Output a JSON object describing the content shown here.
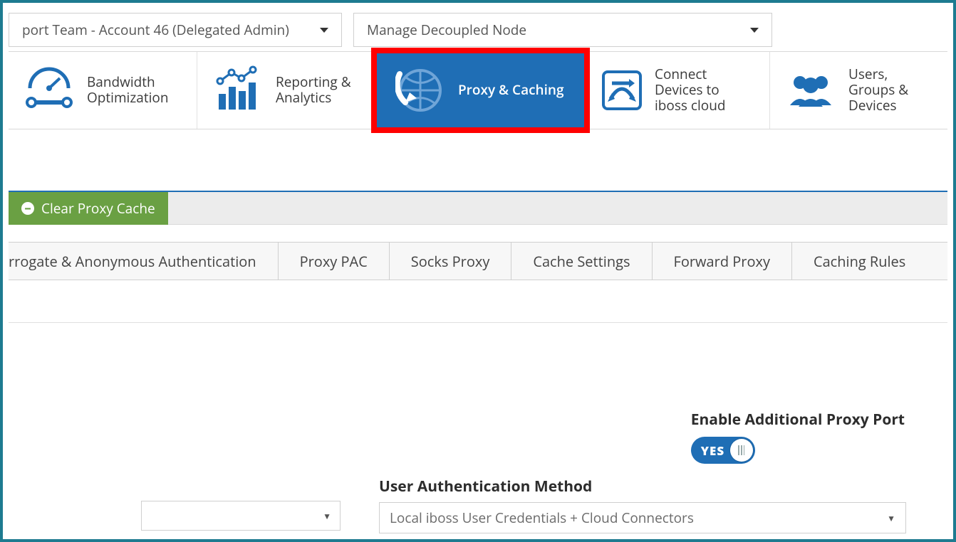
{
  "selectors": {
    "account": "port Team - Account 46 (Delegated Admin)",
    "node": "Manage Decoupled Node"
  },
  "nav": {
    "bandwidth": "Bandwidth Optimization",
    "reporting": "Reporting & Analytics",
    "proxy": "Proxy & Caching",
    "connect": "Connect Devices to iboss cloud",
    "users": "Users, Groups & Devices"
  },
  "actions": {
    "clear_cache": "Clear Proxy Cache"
  },
  "tabs": {
    "t0": "rrogate & Anonymous Authentication",
    "t1": "Proxy PAC",
    "t2": "Socks Proxy",
    "t3": "Cache Settings",
    "t4": "Forward Proxy",
    "t5": "Caching Rules"
  },
  "settings": {
    "enable_additional_port_label": "Enable Additional Proxy Port",
    "toggle_value": "YES",
    "auth_method_label": "User Authentication Method",
    "auth_method_value": "Local iboss User Credentials + Cloud Connectors"
  }
}
